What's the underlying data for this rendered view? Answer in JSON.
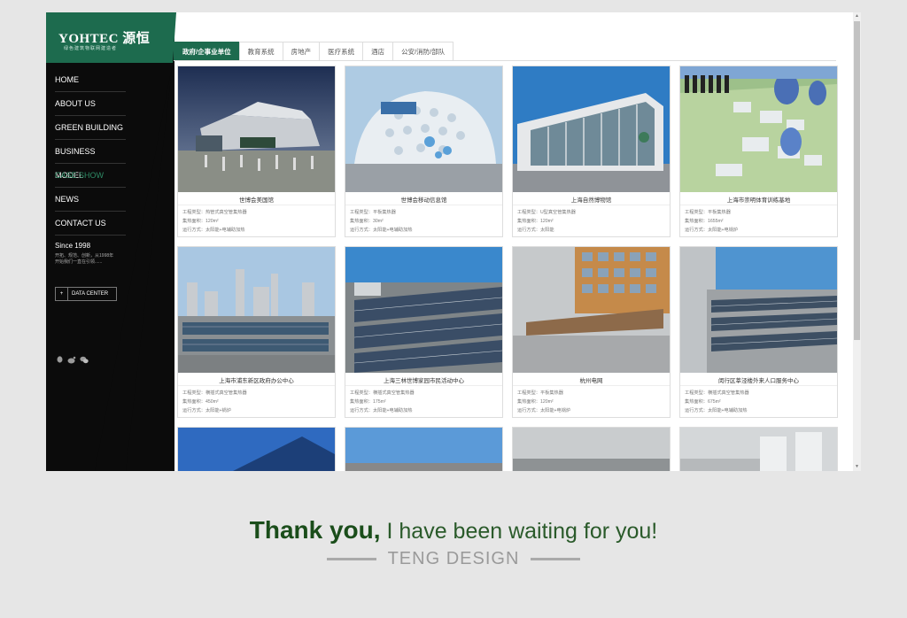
{
  "logo": {
    "title": "YOHTEC 源恒",
    "subtitle": "绿色建筑物联网建造者"
  },
  "nav": {
    "items": [
      {
        "label": "HOME"
      },
      {
        "label": "ABOUT US"
      },
      {
        "label": "GREEN BUILDING"
      },
      {
        "label": "BUSINESS MODEL"
      },
      {
        "label": "CASE SHOW",
        "active": true
      },
      {
        "label": "NEWS"
      },
      {
        "label": "CONTACT US"
      }
    ]
  },
  "since": {
    "title": "Since 1998",
    "desc": "开拓、规范、创新，从1998年开始我们一直在引领......"
  },
  "data_center": {
    "plus": "+",
    "label": "DATA CENTER"
  },
  "social_icons": [
    "qq-icon",
    "weibo-icon",
    "wechat-icon"
  ],
  "tabs": [
    "政府/企事业单位",
    "教育系统",
    "房地产",
    "医疗系统",
    "酒店",
    "公安/消防/部队"
  ],
  "cards": [
    {
      "title": "世博会美国馆",
      "type": "工程类型：热管式真空管集热器",
      "area": "集热面积：120m²",
      "mode": "运行方式：太阳能+电辅助加热"
    },
    {
      "title": "世博会移动信息馆",
      "type": "工程类型：平板集热器",
      "area": "集热面积：30m²",
      "mode": "运行方式：太阳能+电辅助加热"
    },
    {
      "title": "上海自然博物馆",
      "type": "工程类型：U型真空管集热器",
      "area": "集热面积：120m²",
      "mode": "运行方式：太阳能"
    },
    {
      "title": "上海市崇明体育训练基地",
      "type": "工程类型：平板集热器",
      "area": "集热面积：1655m²",
      "mode": "运行方式：太阳能+电锅炉"
    },
    {
      "title": "上海市浦东新区政府办公中心",
      "type": "工程类型：横插式真空管集热器",
      "area": "集热面积：450m²",
      "mode": "运行方式：太阳能+锅炉"
    },
    {
      "title": "上海三林世博家园市民活动中心",
      "type": "工程类型：横插式真空管集热器",
      "area": "集热面积：175m²",
      "mode": "运行方式：太阳能+电辅助加热"
    },
    {
      "title": "杭州电网",
      "type": "工程类型：平板集热器",
      "area": "集热面积：120m²",
      "mode": "运行方式：太阳能+电锅炉"
    },
    {
      "title": "闵行区莘泾楼外来人口服务中心",
      "type": "工程类型：横插式真空管集热器",
      "area": "集热面积：675m²",
      "mode": "运行方式：太阳能+电辅助加热"
    }
  ],
  "footer": {
    "thanks_bold": "Thank you,",
    "thanks_light": " I have been waiting for you!",
    "brand": "TENG DESIGN"
  },
  "colors": {
    "brand_green": "#1d6b4e",
    "sidebar_black": "#0b0b0b",
    "active_nav": "#2e8b65"
  }
}
